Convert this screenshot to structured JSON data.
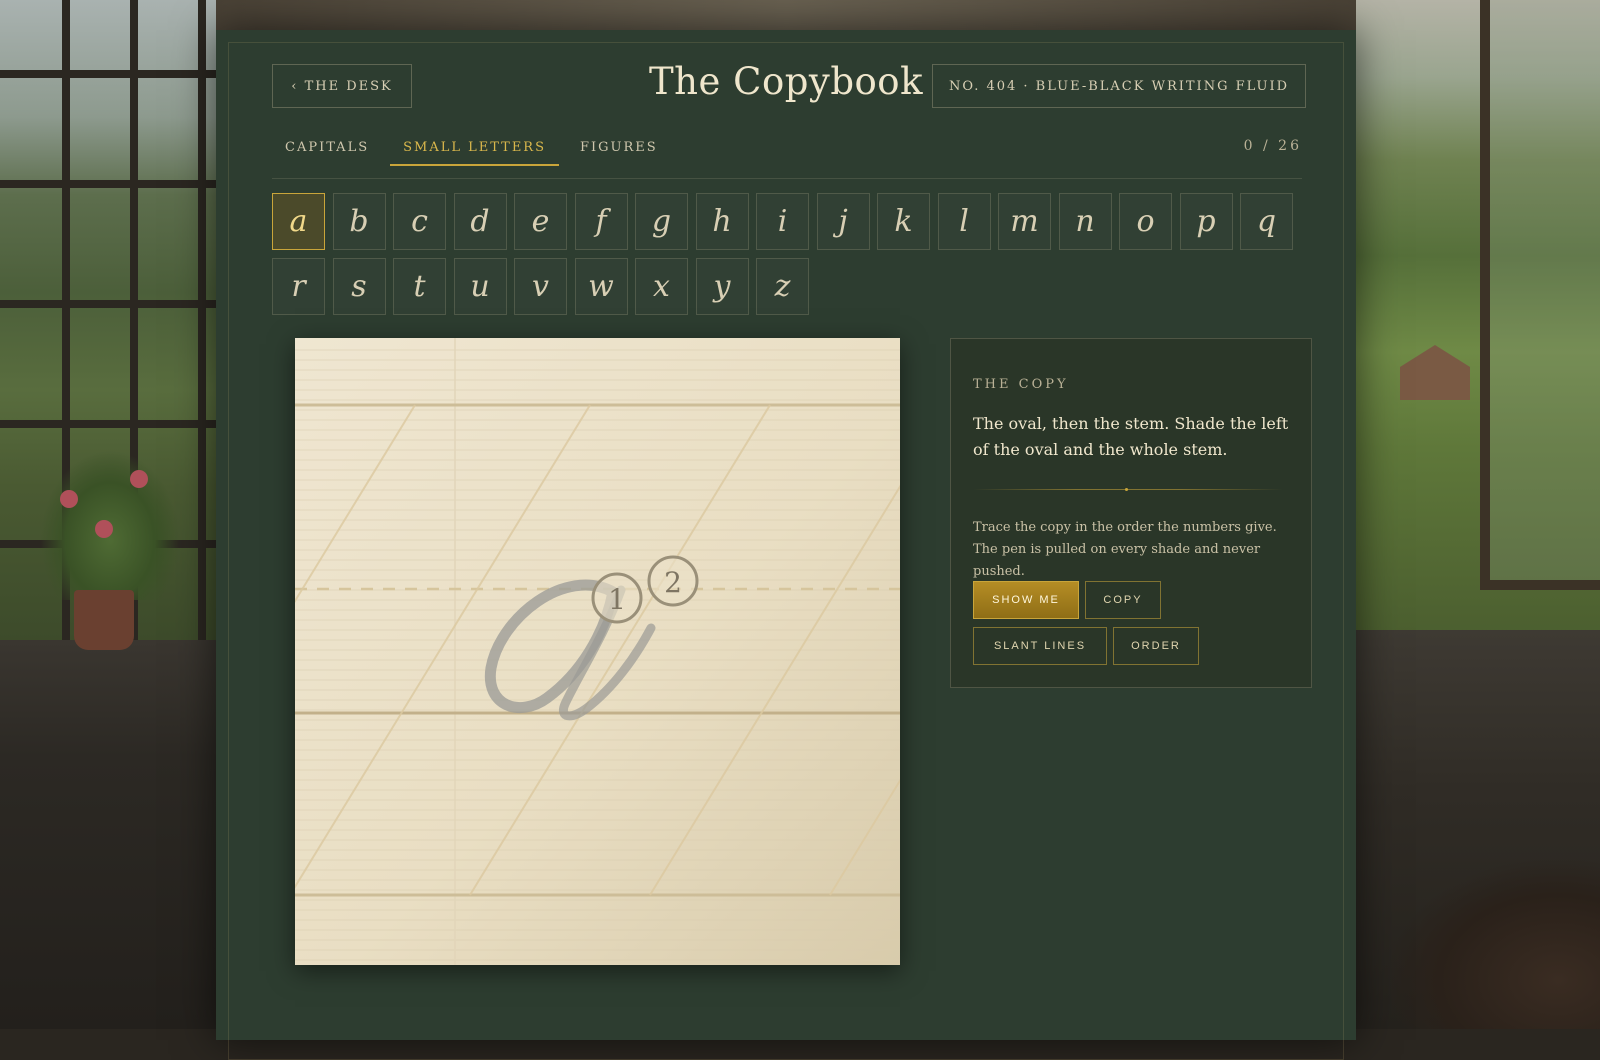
{
  "header": {
    "back_label": "‹ The Desk",
    "title": "The Copybook",
    "ink_label": "No. 404 · Blue-Black Writing Fluid"
  },
  "tabs": [
    {
      "label": "Capitals",
      "active": false
    },
    {
      "label": "Small Letters",
      "active": true
    },
    {
      "label": "Figures",
      "active": false
    }
  ],
  "progress": {
    "text": "0 / 26",
    "done": 0,
    "total": 26
  },
  "letters": [
    "a",
    "b",
    "c",
    "d",
    "e",
    "f",
    "g",
    "h",
    "i",
    "j",
    "k",
    "l",
    "m",
    "n",
    "o",
    "p",
    "q",
    "r",
    "s",
    "t",
    "u",
    "v",
    "w",
    "x",
    "y",
    "z"
  ],
  "selected_letter": "a",
  "sheet": {
    "letter": "a",
    "stroke_numbers": [
      "1",
      "2"
    ]
  },
  "card": {
    "label": "The Copy",
    "heading": "The oval, then the stem. Shade the left of the oval and the whole stem.",
    "body": "Trace the copy in the order the numbers give. The pen is pulled on every shade and never pushed.",
    "buttons": {
      "show_me": "Show Me",
      "copy": "Copy",
      "slant_lines": "Slant Lines",
      "order": "Order"
    }
  },
  "colors": {
    "panel": "#2d3d30",
    "accent_gold": "#c9a53a",
    "paper": "#efe6d1",
    "text_light": "#efe6cc"
  }
}
